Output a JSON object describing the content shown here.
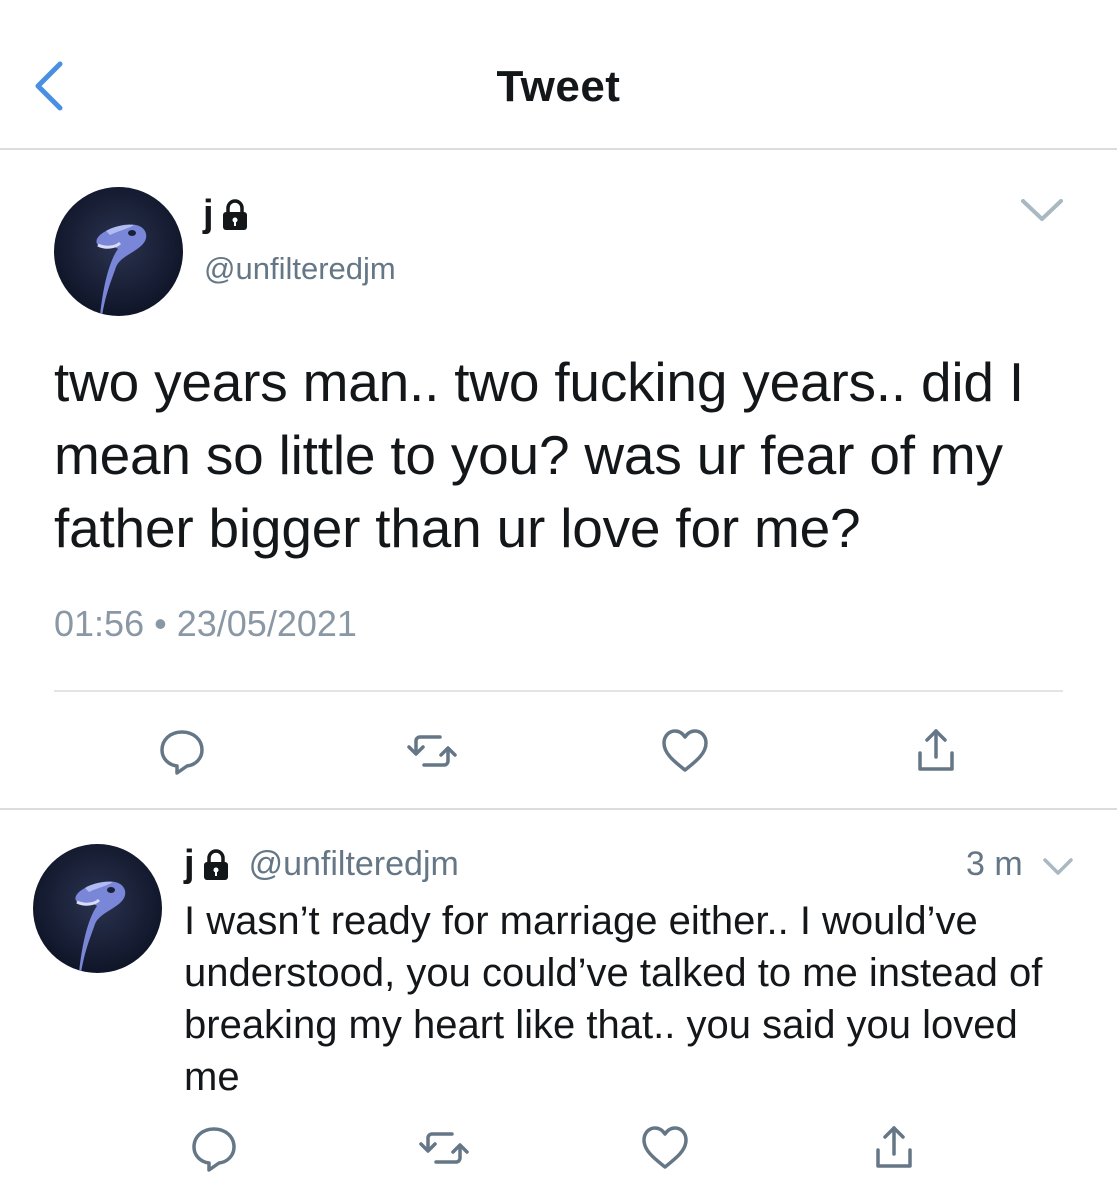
{
  "header": {
    "title": "Tweet",
    "back_icon": "chevron-left-icon",
    "accent_color": "#4a90e2"
  },
  "main_tweet": {
    "name": "j",
    "handle": "@unfilteredjm",
    "text": "two years man.. two fucking years.. did I mean so little to you? was ur fear of my father bigger than ur love for me?",
    "time": "01:56",
    "date": "23/05/2021",
    "meta_separator": "•",
    "icons": [
      "reply-icon",
      "retweet-icon",
      "like-icon",
      "share-icon"
    ]
  },
  "reply_tweet": {
    "name": "j",
    "handle": "@unfilteredjm",
    "time": "3 m",
    "text": "I wasn’t ready for marriage either.. I would’ve understood, you could’ve talked to me instead of breaking my heart like that.. you said you loved me",
    "icons": [
      "reply-icon",
      "retweet-icon",
      "like-icon",
      "share-icon"
    ]
  },
  "colors": {
    "text": "#14171a",
    "secondary": "#657786",
    "divider": "#d9dde0"
  }
}
